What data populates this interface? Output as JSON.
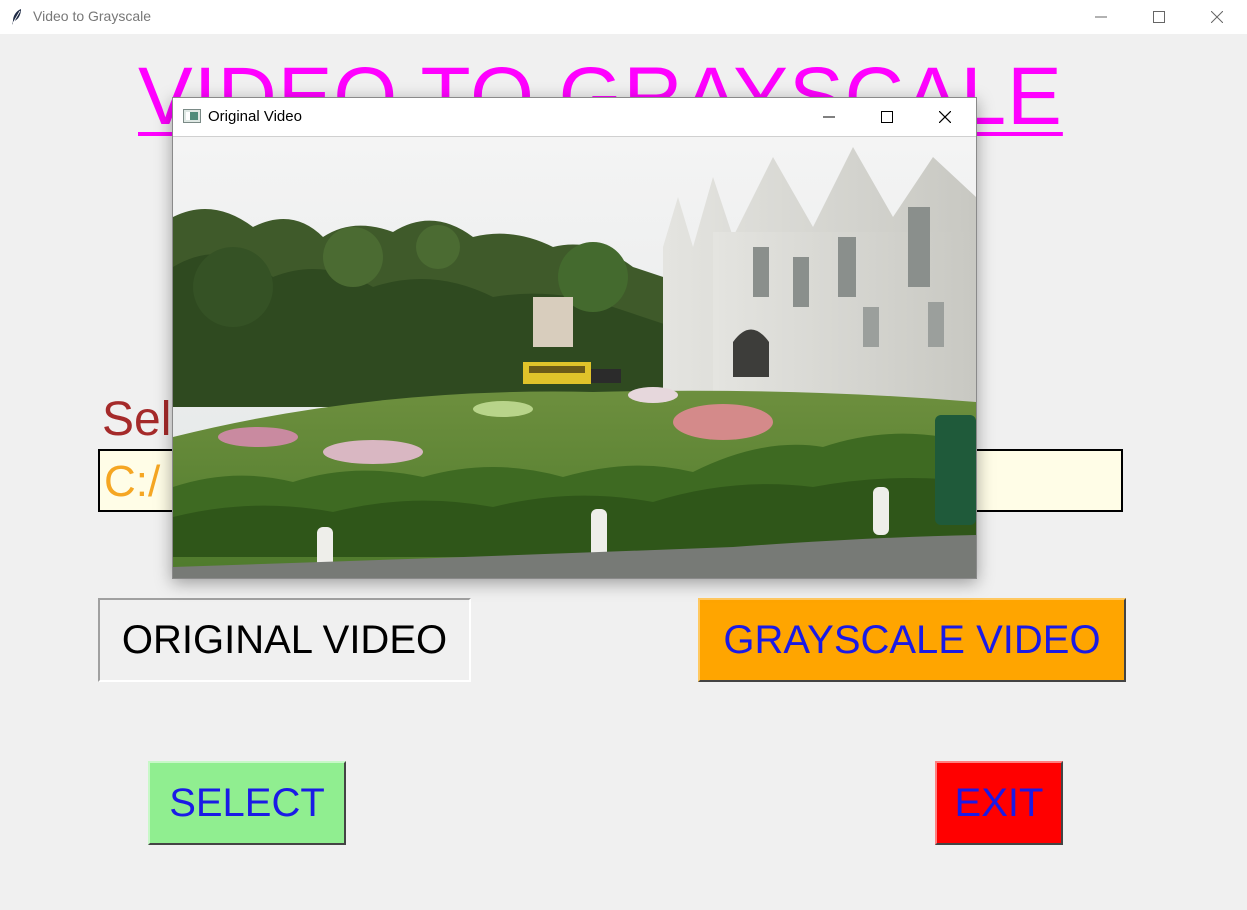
{
  "window": {
    "title": "Video to Grayscale"
  },
  "main": {
    "heading": "VIDEO TO GRAYSCALE",
    "select_label": "Sel",
    "path_value": "C:/"
  },
  "buttons": {
    "original_video": "ORIGINAL VIDEO",
    "grayscale_video": "GRAYSCALE VIDEO",
    "select": "SELECT",
    "exit": "EXIT"
  },
  "video_window": {
    "title": "Original Video"
  },
  "colors": {
    "heading": "#ff00ff",
    "select_label": "#a52a2a",
    "path_text": "#f5a623",
    "path_bg": "#fffde7",
    "grayscale_button": "#ffa500",
    "select_button": "#90ee90",
    "exit_button": "#ff0000",
    "button_text": "#1a1ae6"
  }
}
